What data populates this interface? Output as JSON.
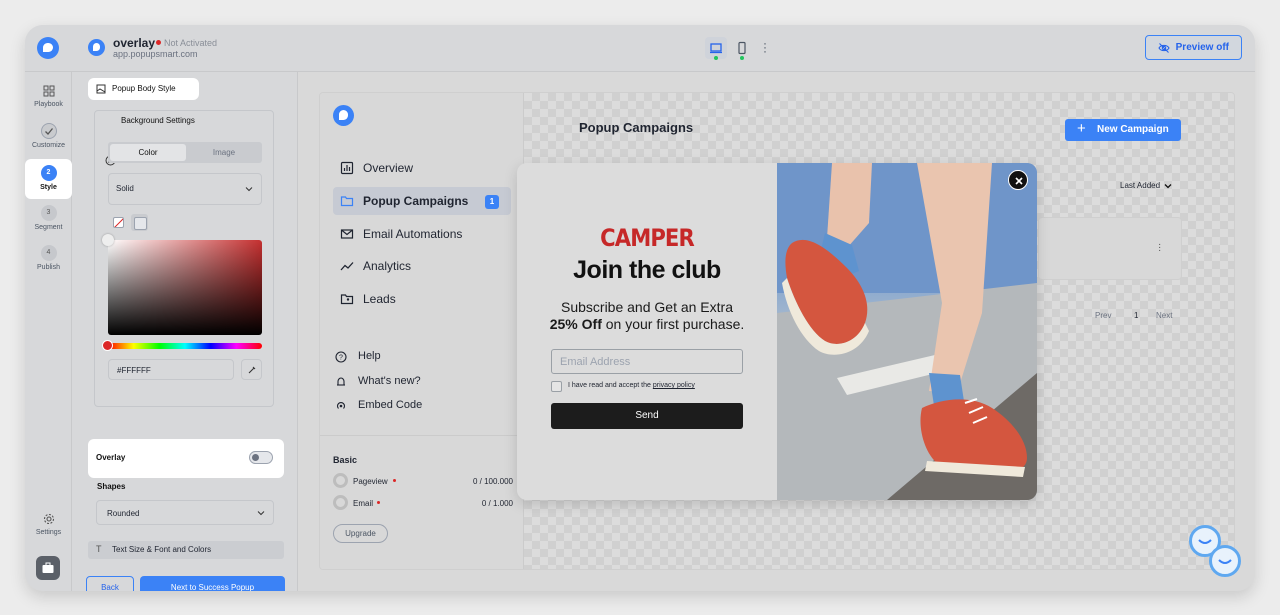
{
  "site": {
    "name": "overlay",
    "status": "Not Activated",
    "url": "app.popupsmart.com"
  },
  "header": {
    "preview_label": "Preview off"
  },
  "leftnav": {
    "items": [
      {
        "label": "Playbook"
      },
      {
        "label": "Customize"
      },
      {
        "label": "Style",
        "step": "2"
      },
      {
        "label": "Segment",
        "step": "3"
      },
      {
        "label": "Publish",
        "step": "4"
      },
      {
        "label": "Settings"
      }
    ]
  },
  "panel": {
    "section_title": "Popup Body Style",
    "background_settings": "Background Settings",
    "tabs": {
      "color": "Color",
      "image": "Image"
    },
    "fill_type": "Solid",
    "hex_value": "#FFFFFF",
    "overlay_label": "Overlay",
    "overlay_on": false,
    "shapes_label": "Shapes",
    "shape_value": "Rounded",
    "text_section": "Text Size & Font and Colors",
    "back_label": "Back",
    "next_label": "Next to Success Popup"
  },
  "dashboard": {
    "menu": [
      {
        "label": "Overview"
      },
      {
        "label": "Popup Campaigns",
        "count": "1"
      },
      {
        "label": "Email Automations"
      },
      {
        "label": "Analytics"
      },
      {
        "label": "Leads"
      }
    ],
    "secondary": [
      {
        "label": "Help"
      },
      {
        "label": "What's new?"
      },
      {
        "label": "Embed Code"
      }
    ],
    "plan": "Basic",
    "usage": [
      {
        "label": "Pageview",
        "value": "0 / 100.000"
      },
      {
        "label": "Email",
        "value": "0 / 1.000"
      }
    ],
    "upgrade": "Upgrade",
    "title": "Popup Campaigns",
    "new_campaign": "New Campaign",
    "sort": "Last Added",
    "pager": {
      "prev": "Prev",
      "page": "1",
      "next": "Next"
    }
  },
  "popup": {
    "brand": "CAMPER",
    "headline": "Join the club",
    "subtitle_line1": "Subscribe and Get an Extra",
    "subtitle_bold": "25% Off",
    "subtitle_line2_rest": " on your first purchase.",
    "email_placeholder": "Email Address",
    "consent_text": "I have read and accept the ",
    "consent_link": "privacy policy",
    "send_label": "Send"
  },
  "colors": {
    "accent": "#3b82f6",
    "brand_red": "#c62828",
    "send_button": "#1c1c1c"
  }
}
